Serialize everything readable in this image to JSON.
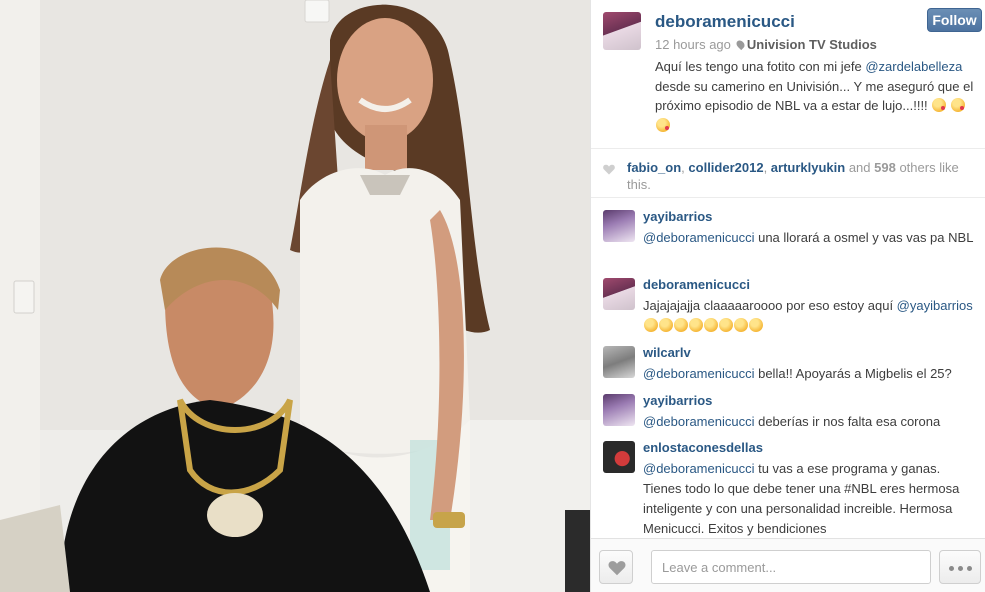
{
  "post": {
    "author": "deboramenicucci",
    "follow_label": "Follow",
    "time_ago": "12 hours ago",
    "location": "Univision TV Studios",
    "caption_1": "Aquí les tengo una fotito con mi jefe ",
    "caption_mention": "@zardelabelleza",
    "caption_2": " desde su camerino en Univisión... Y me aseguró que el próximo episodio de NBL va a estar de lujo...!!!! "
  },
  "likes": {
    "user1": "fabio_on",
    "sep1": ", ",
    "user2": "collider2012",
    "sep2": ", ",
    "user3": "arturklyukin",
    "and_text": " and ",
    "count": "598",
    "others_text": " others like this."
  },
  "comments": [
    {
      "user": "yayibarrios",
      "mention": "@deboramenicucci",
      "text": " una llorará a osmel y vas vas pa NBL"
    },
    {
      "user": "deboramenicucci",
      "text_pre": "Jajajajajja claaaaaroooo por eso estoy aquí ",
      "mention": "@yayibarrios",
      "text": ""
    },
    {
      "user": "wilcarlv",
      "mention": "@deboramenicucci",
      "text": " bella!! Apoyarás a Migbelis el 25?"
    },
    {
      "user": "yayibarrios",
      "mention": "@deboramenicucci",
      "text": " deberías ir nos falta esa corona"
    },
    {
      "user": "enlostaconesdellas",
      "mention": "@deboramenicucci",
      "text": " tu vas a ese programa y ganas. Tienes todo lo que debe tener una #NBL eres hermosa inteligente y con una personalidad increible. Hermosa Menicucci. Exitos y bendiciones"
    }
  ],
  "footer": {
    "comment_placeholder": "Leave a comment..."
  },
  "icons": {
    "location": "pin-icon",
    "like": "heart-icon",
    "more": "ellipsis-icon"
  },
  "colors": {
    "link": "#2a5884",
    "follow_button": "#4d73a0",
    "muted_text": "#9a9a9a"
  }
}
